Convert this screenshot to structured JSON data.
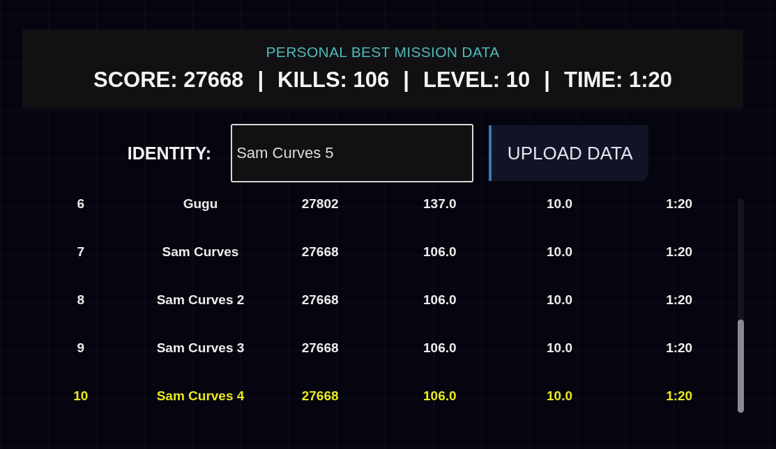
{
  "best_panel": {
    "title": "PERSONAL BEST MISSION DATA",
    "separator": "|",
    "stats": [
      "SCORE: 27668",
      "KILLS: 106",
      "LEVEL: 10",
      "TIME: 1:20"
    ]
  },
  "upload": {
    "label": "IDENTITY:",
    "value": "Sam Curves 5",
    "button": "UPLOAD DATA"
  },
  "leaderboard": {
    "rows": [
      {
        "cells": [
          "6",
          "Gugu",
          "27802",
          "137.0",
          "10.0",
          "1:20"
        ],
        "highlighted": false
      },
      {
        "cells": [
          "7",
          "Sam Curves",
          "27668",
          "106.0",
          "10.0",
          "1:20"
        ],
        "highlighted": false
      },
      {
        "cells": [
          "8",
          "Sam Curves 2",
          "27668",
          "106.0",
          "10.0",
          "1:20"
        ],
        "highlighted": false
      },
      {
        "cells": [
          "9",
          "Sam Curves 3",
          "27668",
          "106.0",
          "10.0",
          "1:20"
        ],
        "highlighted": false
      },
      {
        "cells": [
          "10",
          "Sam Curves 4",
          "27668",
          "106.0",
          "10.0",
          "1:20"
        ],
        "highlighted": true
      }
    ]
  }
}
